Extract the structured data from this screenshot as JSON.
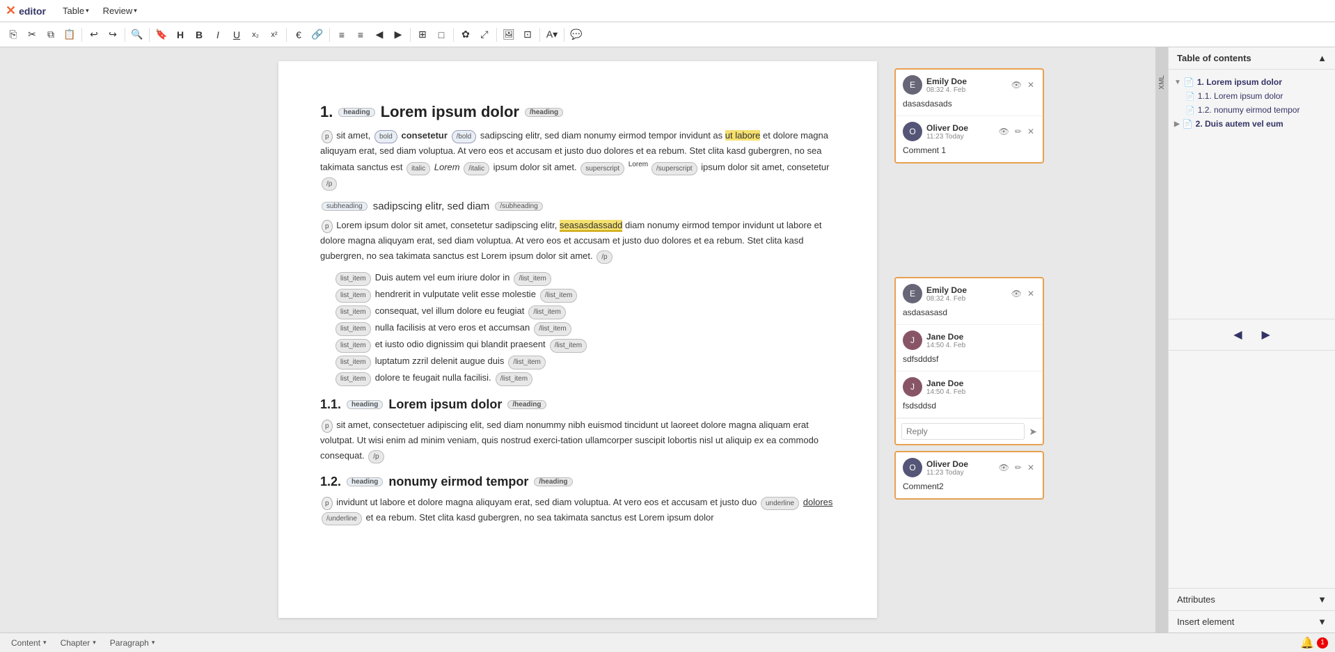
{
  "app": {
    "logo_x": "✕",
    "logo_text": "editor"
  },
  "menubar": {
    "table_label": "Table",
    "review_label": "Review"
  },
  "toolbar": {
    "buttons": [
      "⎘",
      "✂",
      "⎘",
      "📋",
      "↩",
      "↪",
      "🔍",
      "🔖",
      "H",
      "B",
      "I",
      "U",
      "x₂",
      "x²",
      "€",
      "🔗",
      "≡",
      "≡",
      "◀",
      "▶",
      "⊞",
      "□",
      "🐾",
      "⤢",
      "🖼",
      "⊡",
      "A",
      "💬"
    ]
  },
  "toc": {
    "title": "Table of contents",
    "items": [
      {
        "level": 1,
        "label": "1. Lorem ipsum dolor",
        "expanded": true,
        "type": "heading"
      },
      {
        "level": 2,
        "label": "1.1. Lorem ipsum dolor",
        "type": "file"
      },
      {
        "level": 2,
        "label": "1.2. nonumy eirmod tempor",
        "type": "file"
      },
      {
        "level": 1,
        "label": "2. Duis autem vel eum",
        "expanded": false,
        "type": "heading"
      }
    ]
  },
  "nav": {
    "prev": "◀",
    "next": "▶"
  },
  "panels": {
    "attributes_label": "Attributes",
    "insert_element_label": "Insert element"
  },
  "editor": {
    "section1": {
      "heading": "1.",
      "heading_tag_open": "heading",
      "heading_text": "Lorem ipsum dolor",
      "heading_tag_close": "/heading",
      "para_tag": "p",
      "para_bold_open": "bold",
      "para_bold_text": "consetetur",
      "para_bold_close": "/bold",
      "para_text1": "sit amet,",
      "para_text2": "sadipscing elitr, sed diam nonumy eirmod tempor invidunt as",
      "para_highlight": "ut labore",
      "para_text3": "et dolore magna aliquyam erat, sed diam voluptua. At vero eos et accusam et justo duo dolores et ea rebum. Stet clita kasd gubergren, no sea takimata sanctus est",
      "italic_open": "italic",
      "italic_text": "Lorem",
      "italic_close": "/italic",
      "para_text4": "ipsum dolor sit amet.",
      "sup_open": "superscript",
      "sup_text": "Lorem",
      "sup_close": "/superscript",
      "para_text5": "ipsum dolor sit amet, consetetur",
      "para_close": "/p"
    },
    "subheading": {
      "tag_open": "subheading",
      "text": "sadipscing elitr, sed diam",
      "tag_close": "/subheading"
    },
    "para2": {
      "tag": "p",
      "text1": "Lorem ipsum dolor sit amet, consetetur sadipscing elitr,",
      "highlight": "seasasdassadd",
      "text2": "diam nonumy eirmod tempor invidunt ut labore et dolore magna aliquyam erat, sed diam voluptua. At vero eos et accusam et justo duo dolores et ea rebum. Stet clita kasd gubergren, no sea takimata sanctus est Lorem ipsum dolor sit amet.",
      "tag_close": "/p"
    },
    "list": {
      "items": [
        "Duis autem vel eum iriure dolor in",
        "hendrerit in vulputate velit esse molestie",
        "consequat, vel illum dolore eu feugiat",
        "nulla facilisis at vero eros et accumsan",
        "et iusto odio dignissim qui blandit praesent",
        "luptatum zzril delenit augue duis",
        "dolore te feugait nulla facilisi."
      ],
      "item_tag_open": "list_item",
      "item_tag_close": "/list_item"
    },
    "section11": {
      "number": "1.1.",
      "tag_open": "heading",
      "text": "Lorem ipsum dolor",
      "tag_close": "/heading",
      "para_tag": "p",
      "para_text": "sit amet, consectetuer adipiscing elit, sed diam nonummy nibh euismod tincidunt ut laoreet dolore magna aliquam erat volutpat. Ut wisi enim ad minim veniam, quis nostrud exerci-tation ullamcorper suscipit lobortis nisl ut aliquip ex ea commodo consequat.",
      "para_close": "/p"
    },
    "section12": {
      "number": "1.2.",
      "tag_open": "heading",
      "text": "nonumy eirmod tempor",
      "tag_close": "/heading",
      "para_tag": "p",
      "para_text1": "invidunt ut labore et dolore magna aliquyam erat, sed diam voluptua. At vero eos et accusam et justo duo",
      "underline_open": "underline",
      "underline_text": "dolores",
      "underline_close": "/underline",
      "para_text2": "et ea rebum. Stet clita kasd gubergren, no sea takimata sanctus est Lorem ipsum dolor"
    }
  },
  "comments": {
    "thread1": {
      "comment1": {
        "author": "Emily Doe",
        "time": "08:32 4. Feb",
        "text": "dasasdasads",
        "avatar_initials": "E"
      },
      "comment2": {
        "author": "Oliver Doe",
        "time": "11:23 Today",
        "text": "Comment 1",
        "avatar_initials": "O"
      }
    },
    "thread2": {
      "comment1": {
        "author": "Emily Doe",
        "time": "08:32 4. Feb",
        "text": "asdasasasd",
        "avatar_initials": "E"
      },
      "comment2": {
        "author": "Jane Doe",
        "time": "14:50 4. Feb",
        "text": "sdfsdddsf",
        "avatar_initials": "J"
      },
      "comment3": {
        "author": "Jane Doe",
        "time": "14:50 4. Feb",
        "text": "fsdsddsd",
        "avatar_initials": "J"
      },
      "reply_placeholder": "Reply",
      "reply_send": "➤"
    },
    "thread3": {
      "comment1": {
        "author": "Oliver Doe",
        "time": "11:23 Today",
        "text": "Comment2",
        "avatar_initials": "O"
      }
    }
  },
  "statusbar": {
    "content_label": "Content",
    "chapter_label": "Chapter",
    "paragraph_label": "Paragraph",
    "bell_count": "1"
  }
}
